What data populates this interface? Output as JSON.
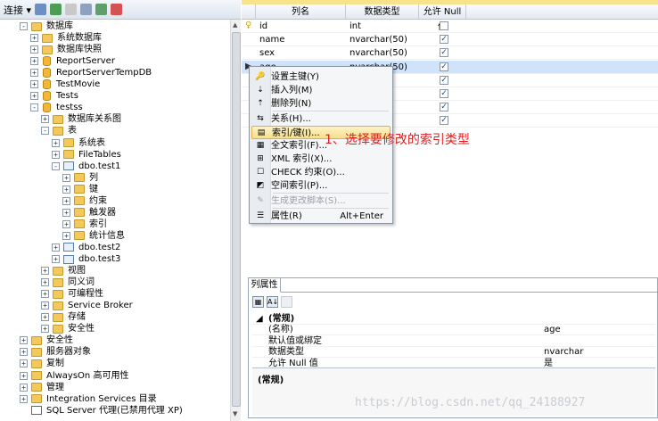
{
  "toolbar": {
    "connect_label": "连接 ▾"
  },
  "tree": [
    {
      "label": "数据库",
      "level": 1,
      "exp": "−",
      "icon": "folder"
    },
    {
      "label": "系统数据库",
      "level": 2,
      "exp": "+",
      "icon": "folder"
    },
    {
      "label": "数据库快照",
      "level": 2,
      "exp": "+",
      "icon": "folder"
    },
    {
      "label": "ReportServer",
      "level": 2,
      "exp": "+",
      "icon": "db"
    },
    {
      "label": "ReportServerTempDB",
      "level": 2,
      "exp": "+",
      "icon": "db"
    },
    {
      "label": "TestMovie",
      "level": 2,
      "exp": "+",
      "icon": "db"
    },
    {
      "label": "Tests",
      "level": 2,
      "exp": "+",
      "icon": "db"
    },
    {
      "label": "testss",
      "level": 2,
      "exp": "−",
      "icon": "db"
    },
    {
      "label": "数据库关系图",
      "level": 3,
      "exp": "+",
      "icon": "folder"
    },
    {
      "label": "表",
      "level": 3,
      "exp": "−",
      "icon": "folder"
    },
    {
      "label": "系统表",
      "level": 4,
      "exp": "+",
      "icon": "folder"
    },
    {
      "label": "FileTables",
      "level": 4,
      "exp": "+",
      "icon": "folder"
    },
    {
      "label": "dbo.test1",
      "level": 4,
      "exp": "−",
      "icon": "table"
    },
    {
      "label": "列",
      "level": 5,
      "exp": "+",
      "icon": "folder"
    },
    {
      "label": "键",
      "level": 5,
      "exp": "+",
      "icon": "folder"
    },
    {
      "label": "约束",
      "level": 5,
      "exp": "+",
      "icon": "folder"
    },
    {
      "label": "触发器",
      "level": 5,
      "exp": "+",
      "icon": "folder"
    },
    {
      "label": "索引",
      "level": 5,
      "exp": "+",
      "icon": "folder"
    },
    {
      "label": "统计信息",
      "level": 5,
      "exp": "+",
      "icon": "folder"
    },
    {
      "label": "dbo.test2",
      "level": 4,
      "exp": "+",
      "icon": "table"
    },
    {
      "label": "dbo.test3",
      "level": 4,
      "exp": "+",
      "icon": "table"
    },
    {
      "label": "视图",
      "level": 3,
      "exp": "+",
      "icon": "folder"
    },
    {
      "label": "同义词",
      "level": 3,
      "exp": "+",
      "icon": "folder"
    },
    {
      "label": "可编程性",
      "level": 3,
      "exp": "+",
      "icon": "folder"
    },
    {
      "label": "Service Broker",
      "level": 3,
      "exp": "+",
      "icon": "folder"
    },
    {
      "label": "存储",
      "level": 3,
      "exp": "+",
      "icon": "folder"
    },
    {
      "label": "安全性",
      "level": 3,
      "exp": "+",
      "icon": "folder"
    },
    {
      "label": "安全性",
      "level": 1,
      "exp": "+",
      "icon": "folder"
    },
    {
      "label": "服务器对象",
      "level": 1,
      "exp": "+",
      "icon": "folder"
    },
    {
      "label": "复制",
      "level": 1,
      "exp": "+",
      "icon": "folder"
    },
    {
      "label": "AlwaysOn 高可用性",
      "level": 1,
      "exp": "+",
      "icon": "folder"
    },
    {
      "label": "管理",
      "level": 1,
      "exp": "+",
      "icon": "folder"
    },
    {
      "label": "Integration Services 目录",
      "level": 1,
      "exp": "+",
      "icon": "folder"
    },
    {
      "label": "SQL Server 代理(已禁用代理 XP)",
      "level": 1,
      "exp": "",
      "icon": "server"
    }
  ],
  "grid": {
    "headers": [
      "列名",
      "数据类型",
      "允许 Null 值"
    ],
    "rows": [
      {
        "name": "id",
        "type": "int",
        "nullable": false,
        "pk": true
      },
      {
        "name": "name",
        "type": "nvarchar(50)",
        "nullable": true,
        "pk": false
      },
      {
        "name": "sex",
        "type": "nvarchar(50)",
        "nullable": true,
        "pk": false
      },
      {
        "name": "age",
        "type": "nvarchar(50)",
        "nullable": true,
        "pk": false,
        "selected": true
      },
      {
        "name": "",
        "type": "",
        "nullable": true,
        "pk": false
      },
      {
        "name": "",
        "type": "",
        "nullable": true,
        "pk": false
      },
      {
        "name": "",
        "type": "",
        "nullable": true,
        "pk": false
      },
      {
        "name": "",
        "type": "",
        "nullable": true,
        "pk": false
      }
    ]
  },
  "context_menu": {
    "items": [
      {
        "label": "设置主键(Y)",
        "shortcut": "",
        "icon": "key-icon",
        "glyph": "🔑"
      },
      {
        "label": "插入列(M)",
        "shortcut": "",
        "icon": "insert-column-icon",
        "glyph": "⇣"
      },
      {
        "label": "删除列(N)",
        "shortcut": "",
        "icon": "delete-column-icon",
        "glyph": "⇡"
      },
      {
        "label": "关系(H)...",
        "shortcut": "",
        "icon": "relationship-icon",
        "glyph": "⇆"
      },
      {
        "label": "索引/键(I)...",
        "shortcut": "",
        "icon": "index-key-icon",
        "glyph": "▤",
        "highlight": true
      },
      {
        "label": "全文索引(F)...",
        "shortcut": "",
        "icon": "fulltext-index-icon",
        "glyph": "▦"
      },
      {
        "label": "XML 索引(X)...",
        "shortcut": "",
        "icon": "xml-index-icon",
        "glyph": "⊞"
      },
      {
        "label": "CHECK 约束(O)...",
        "shortcut": "",
        "icon": "check-constraint-icon",
        "glyph": "☐"
      },
      {
        "label": "空间索引(P)...",
        "shortcut": "",
        "icon": "spatial-index-icon",
        "glyph": "◩"
      },
      {
        "label": "生成更改脚本(S)...",
        "shortcut": "",
        "icon": "script-icon",
        "glyph": "✎",
        "disabled": true
      },
      {
        "label": "属性(R)",
        "shortcut": "Alt+Enter",
        "icon": "properties-icon",
        "glyph": "☰"
      }
    ]
  },
  "annotation": "1、选择要修改的索引类型",
  "properties": {
    "tab_label": "列属性",
    "category": "(常规)",
    "rows": [
      {
        "name": "(名称)",
        "value": "age"
      },
      {
        "name": "默认值或绑定",
        "value": ""
      },
      {
        "name": "数据类型",
        "value": "nvarchar"
      },
      {
        "name": "允许 Null 值",
        "value": "是"
      }
    ],
    "description_title": "(常规)"
  },
  "watermark": "https://blog.csdn.net/qq_24188927"
}
